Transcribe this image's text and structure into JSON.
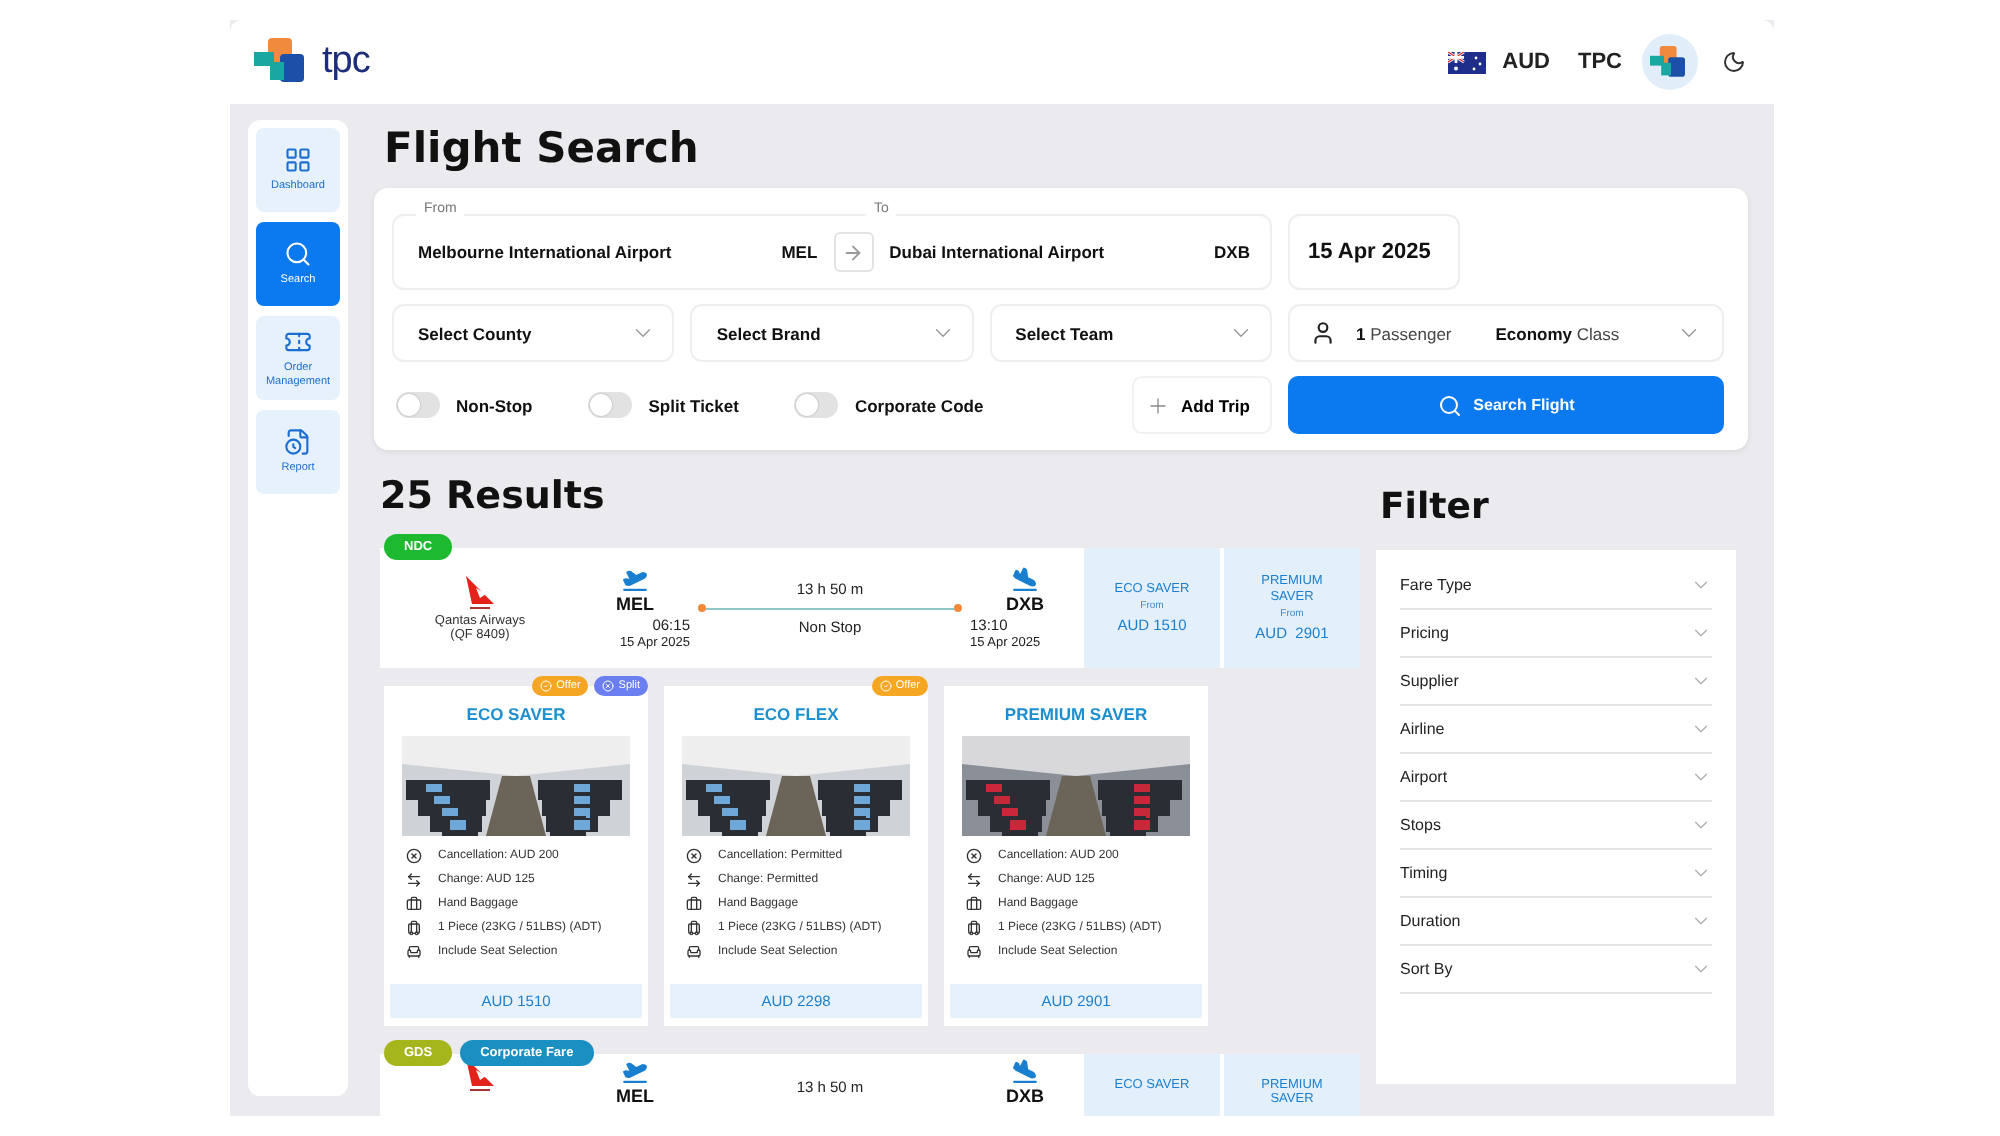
{
  "header": {
    "logo_text": "tpc",
    "currency": "AUD",
    "user": "TPC"
  },
  "sidebar": {
    "items": [
      {
        "kind": "dashboard",
        "label": "Dashboard",
        "selected": false
      },
      {
        "kind": "search",
        "label": "Search",
        "selected": true
      },
      {
        "kind": "orders",
        "label": "Order Management",
        "selected": false
      },
      {
        "kind": "report",
        "label": "Report",
        "selected": false
      }
    ]
  },
  "page_title": "Flight Search",
  "search": {
    "from": {
      "label": "From",
      "airport": "Melbourne International Airport",
      "code": "MEL"
    },
    "to": {
      "label": "To",
      "airport": "Dubai International Airport",
      "code": "DXB"
    },
    "date": "15 Apr 2025",
    "selects": [
      "Select County",
      "Select Brand",
      "Select Team"
    ],
    "passengers": {
      "count": "1",
      "label": "Passenger",
      "cabin": "Economy",
      "cabin_suffix": "Class"
    },
    "toggles": [
      {
        "label": "Non-Stop",
        "on": false
      },
      {
        "label": "Split Ticket",
        "on": false
      },
      {
        "label": "Corporate Code",
        "on": false
      }
    ],
    "add_trip": "Add Trip",
    "search_button": "Search Flight"
  },
  "results_title": "25 Results",
  "results": [
    {
      "badges": [
        {
          "label": "NDC",
          "color": "#1db92f"
        }
      ],
      "airline": "Qantas Airways",
      "flight": "(QF 8409)",
      "depart_code": "MEL",
      "depart_time": "06:15",
      "depart_date": "15 Apr 2025",
      "duration": "13 h 50 m",
      "stops": "Non Stop",
      "arrive_code": "DXB",
      "arrive_time": "13:10",
      "arrive_date": "15 Apr 2025",
      "fares": [
        {
          "name": "ECO SAVER",
          "from": "From",
          "price": "AUD 1510"
        },
        {
          "name": "PREMIUM SAVER",
          "from": "From",
          "price": "AUD  2901"
        }
      ],
      "fare_cards": [
        {
          "name": "ECO SAVER",
          "tags": [
            {
              "label": "Offer",
              "color": "#f5a623"
            },
            {
              "label": "Split",
              "color": "#6b7ff2"
            }
          ],
          "features": [
            {
              "kind": "cancellation",
              "text": "Cancellation: AUD 200"
            },
            {
              "kind": "change",
              "text": "Change: AUD 125"
            },
            {
              "kind": "hand_baggage",
              "text": "Hand Baggage"
            },
            {
              "kind": "checked_baggage",
              "text": "1 Piece (23KG / 51LBS) (ADT)"
            },
            {
              "kind": "seat",
              "text": "Include Seat Selection"
            }
          ],
          "price": "AUD 1510"
        },
        {
          "name": "ECO FLEX",
          "tags": [
            {
              "label": "Offer",
              "color": "#f5a623"
            }
          ],
          "features": [
            {
              "kind": "cancellation",
              "text": "Cancellation: Permitted"
            },
            {
              "kind": "change",
              "text": "Change: Permitted"
            },
            {
              "kind": "hand_baggage",
              "text": "Hand Baggage"
            },
            {
              "kind": "checked_baggage",
              "text": "1 Piece (23KG / 51LBS) (ADT)"
            },
            {
              "kind": "seat",
              "text": "Include Seat Selection"
            }
          ],
          "price": "AUD 2298"
        },
        {
          "name": "PREMIUM SAVER",
          "features": [
            {
              "kind": "cancellation",
              "text": "Cancellation: AUD 200"
            },
            {
              "kind": "change",
              "text": "Change: AUD 125"
            },
            {
              "kind": "hand_baggage",
              "text": "Hand Baggage"
            },
            {
              "kind": "checked_baggage",
              "text": "1 Piece (23KG / 51LBS) (ADT)"
            },
            {
              "kind": "seat",
              "text": "Include Seat Selection"
            }
          ],
          "price": "AUD 2901"
        }
      ]
    },
    {
      "badges": [
        {
          "label": "GDS",
          "color": "#a5b51c"
        },
        {
          "label": "Corporate Fare",
          "color": "#1a8fc2"
        }
      ],
      "depart_code": "MEL",
      "duration": "13 h 50 m",
      "arrive_code": "DXB",
      "fares": [
        {
          "name": "ECO SAVER"
        },
        {
          "name": "PREMIUM SAVER"
        }
      ]
    }
  ],
  "filter": {
    "title": "Filter",
    "items": [
      "Fare Type",
      "Pricing",
      "Supplier",
      "Airline",
      "Airport",
      "Stops",
      "Timing",
      "Duration",
      "Sort By"
    ]
  }
}
